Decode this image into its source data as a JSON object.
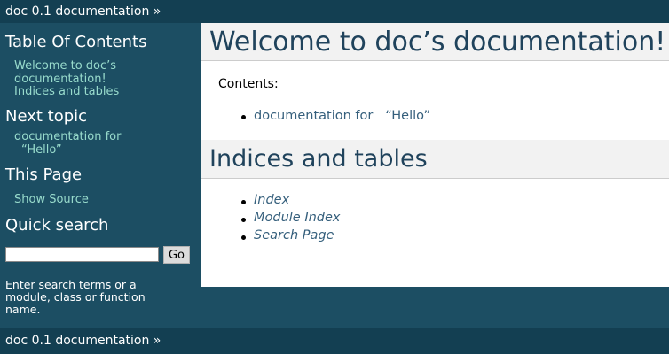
{
  "relbar": {
    "title": "doc 0.1 documentation",
    "suffix": " »"
  },
  "sidebar": {
    "toc_heading": "Table Of Contents",
    "toc_links": [
      "Welcome to doc’s documentation!",
      "Indices and tables"
    ],
    "next_heading": "Next topic",
    "next_link_line1": "documentation for",
    "next_link_line2": "“Hello”",
    "this_page_heading": "This Page",
    "show_source": "Show Source",
    "search_heading": "Quick search",
    "search_value": "",
    "go_label": "Go",
    "search_help": [
      "Enter search terms or a",
      "module, class or function",
      "name."
    ]
  },
  "main": {
    "title": "Welcome to doc’s documentation!",
    "contents_label": "Contents:",
    "contents_items": [
      "documentation for   “Hello”"
    ],
    "indices_heading": "Indices and tables",
    "indices_items": [
      "Index",
      "Module Index",
      "Search Page"
    ]
  },
  "colors": {
    "relbar_bg": "#133f52",
    "sidebar_bg": "#1c4e63",
    "sidebar_link": "#98dbcc",
    "heading_text": "#20435c",
    "link": "#355f7c",
    "heading_bg": "#f2f2f2"
  }
}
